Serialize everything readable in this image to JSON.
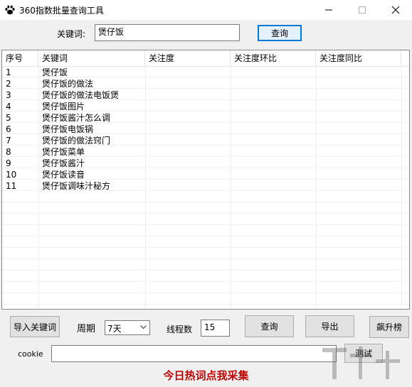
{
  "window": {
    "title": "360指数批量查询工具",
    "min_glyph": "—",
    "max_glyph": "☐",
    "close_glyph": "✕"
  },
  "search": {
    "label": "关键词:",
    "value": "煲仔饭",
    "button": "查询"
  },
  "table": {
    "headers": [
      "序号",
      "关键词",
      "关注度",
      "关注度环比",
      "关注度同比"
    ],
    "rows": [
      [
        "1",
        "煲仔饭",
        "",
        "",
        ""
      ],
      [
        "2",
        "煲仔饭的做法",
        "",
        "",
        ""
      ],
      [
        "3",
        "煲仔饭的做法电饭煲",
        "",
        "",
        ""
      ],
      [
        "4",
        "煲仔饭图片",
        "",
        "",
        ""
      ],
      [
        "5",
        "煲仔饭酱汁怎么调",
        "",
        "",
        ""
      ],
      [
        "6",
        "煲仔饭电饭锅",
        "",
        "",
        ""
      ],
      [
        "7",
        "煲仔饭的做法窍门",
        "",
        "",
        ""
      ],
      [
        "8",
        "煲仔饭菜单",
        "",
        "",
        ""
      ],
      [
        "9",
        "煲仔饭酱汁",
        "",
        "",
        ""
      ],
      [
        "10",
        "煲仔饭读音",
        "",
        "",
        ""
      ],
      [
        "11",
        "煲仔饭调味汁秘方",
        "",
        "",
        ""
      ]
    ]
  },
  "controls": {
    "import_button": "导入关键词",
    "period_label": "周期",
    "period_value": "7天",
    "threads_label": "线程数",
    "threads_value": "15",
    "query_button": "查询",
    "export_button": "导出",
    "rank_button": "飙升榜"
  },
  "cookie": {
    "label": "cookie",
    "value": "",
    "test_button": "测试"
  },
  "promo": {
    "text": "今日热词点我采集"
  },
  "colors": {
    "promo": "#c00000",
    "focus_border": "#0078d7"
  }
}
